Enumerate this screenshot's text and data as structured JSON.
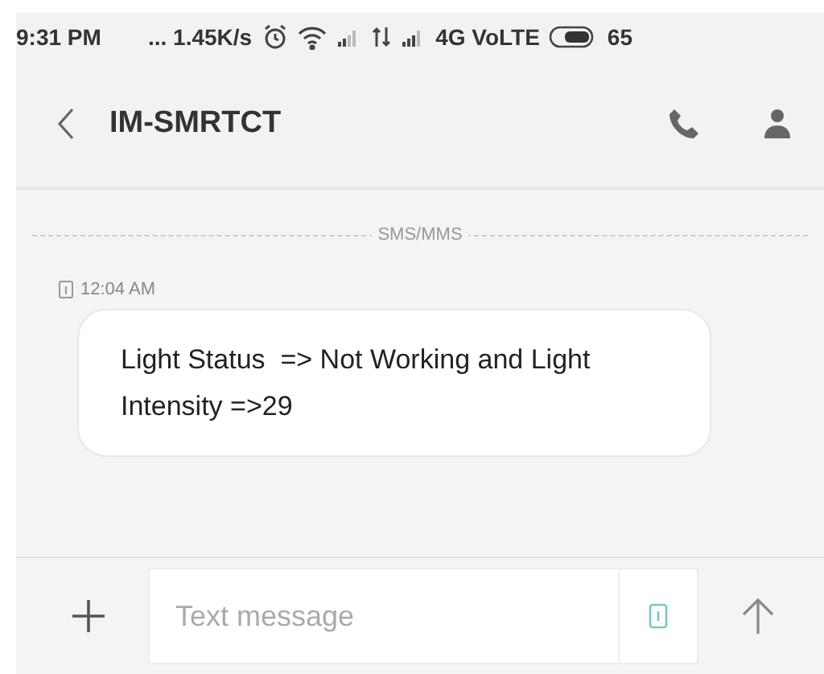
{
  "status_bar": {
    "time": "9:31 PM",
    "speed": "... 1.45K/s",
    "network": "4G VoLTE",
    "battery": "65"
  },
  "header": {
    "title": "IM-SMRTCT"
  },
  "conversation": {
    "channel_label": "SMS/MMS",
    "messages": [
      {
        "time": "12:04 AM",
        "text": "Light Status  => Not Working and Light Intensity =>29"
      }
    ]
  },
  "composer": {
    "placeholder": "Text message"
  }
}
